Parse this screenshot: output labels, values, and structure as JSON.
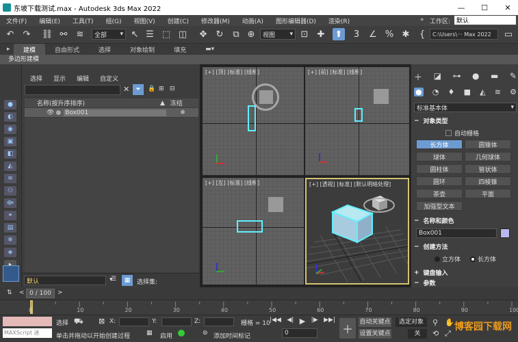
{
  "window": {
    "title": "东坡下载测试.max - Autodesk 3ds Max 2022",
    "minimize": "—",
    "maximize": "☐",
    "close": "✕"
  },
  "menu": [
    "文件(F)",
    "编辑(E)",
    "工具(T)",
    "组(G)",
    "视图(V)",
    "创建(C)",
    "修改器(M)",
    "动画(A)",
    "图形编辑器(D)",
    "渲染(R)"
  ],
  "menu_right": {
    "more": "»",
    "workspace_label": "工作区:",
    "workspace_value": "默认"
  },
  "toolbar": {
    "selection_filter": "全部",
    "view_dropdown": "视图",
    "path_field": "C:\\Users\\··· Max 2022"
  },
  "ribbon": {
    "tabs": [
      "建模",
      "自由形式",
      "选择",
      "对象绘制",
      "填充"
    ],
    "active_tab": "建模",
    "sub_label": "多边形建模"
  },
  "scene_explorer": {
    "tabs": [
      "选择",
      "显示",
      "编辑",
      "自定义"
    ],
    "col_name": "名称(按升序排序)",
    "col_frozen": "冻结",
    "objects": [
      {
        "name": "Box001",
        "frozen": "❄"
      }
    ],
    "layer_value": "默认",
    "selection_set_label": "选择集:"
  },
  "viewports": {
    "top": "[+] [顶] [标准] [线框]",
    "front": "[+] [前] [标准] [线框]",
    "left": "[+] [左] [标准] [线框]",
    "persp": "[+] [透视] [标准] [默认明暗处理]"
  },
  "command_panel": {
    "category": "标准基本体",
    "object_type_title": "对象类型",
    "autogrid_label": "自动栅格",
    "primitives": [
      "长方体",
      "圆锥体",
      "球体",
      "几何球体",
      "圆柱体",
      "管状体",
      "圆环",
      "四棱锥",
      "茶壶",
      "平面",
      "加强型文本"
    ],
    "selected_primitive": "长方体",
    "name_color_title": "名称和颜色",
    "object_name": "Box001",
    "object_color": "#b8b8ee",
    "creation_method_title": "创建方法",
    "creation_options": [
      "立方体",
      "长方体"
    ],
    "creation_selected": "长方体",
    "keyboard_entry_title": "键盘输入",
    "params_title": "参数"
  },
  "timeline": {
    "frame_display": "0 / 100",
    "ticks": [
      "0",
      "10",
      "20",
      "30",
      "40",
      "50",
      "60",
      "70",
      "80",
      "90",
      "100"
    ]
  },
  "status": {
    "maxscript_label": "MAXScript 迷",
    "selection": "选择",
    "x_label": "X:",
    "y_label": "Y:",
    "z_label": "Z:",
    "grid_label": "栅格 = 10",
    "prompt": "单击并拖动以开始创建过程",
    "enable_label": "启用",
    "add_time_tag": "添加时间标记",
    "auto_key": "自动关键点",
    "selected_object": "选定对象",
    "set_key": "设置关键点",
    "key_filter": "关",
    "frame_field": "0",
    "watermark": "博客园下载网"
  },
  "colors": {
    "accent": "#6c9bd2",
    "selection_cyan": "#5ff0ff",
    "active_viewport_border": "#d6c473"
  }
}
